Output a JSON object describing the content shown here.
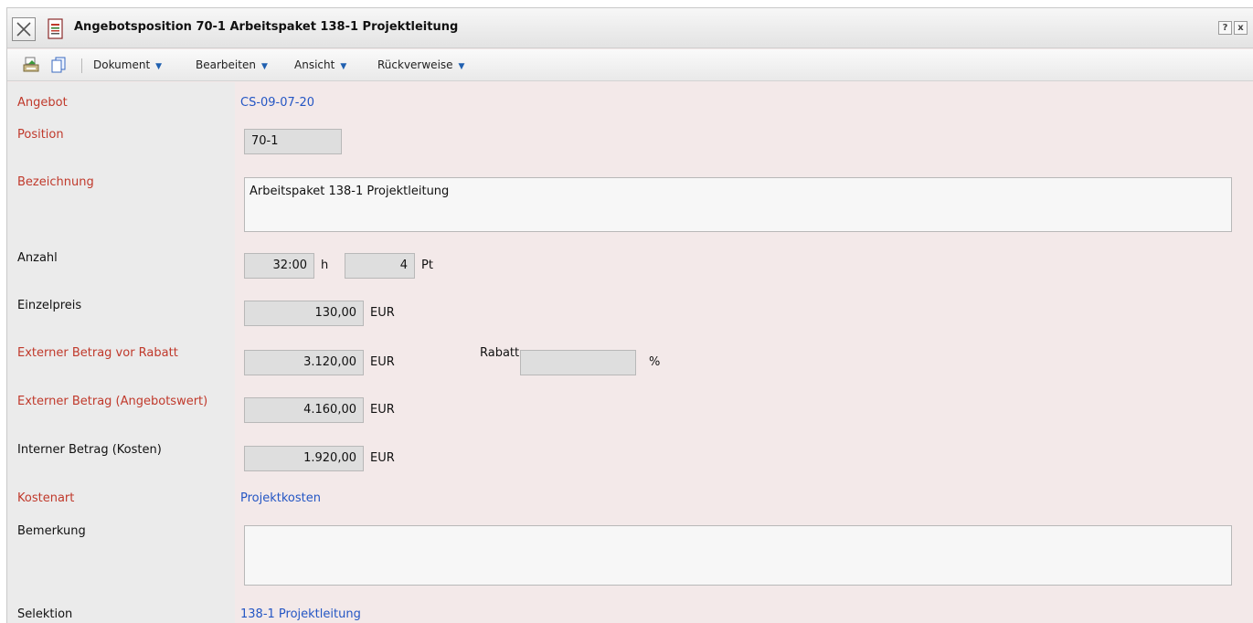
{
  "window": {
    "title": "Angebotsposition 70-1 Arbeitspaket 138-1 Projektleitung",
    "help_btn": "?",
    "close_btn": "x"
  },
  "toolbar": {
    "menus": [
      {
        "label": "Dokument"
      },
      {
        "label": "Bearbeiten"
      },
      {
        "label": "Ansicht"
      },
      {
        "label": "Rückverweise"
      }
    ],
    "caret": "▼"
  },
  "form": {
    "angebot": {
      "label": "Angebot",
      "value": "CS-09-07-20"
    },
    "position": {
      "label": "Position",
      "value": "70-1"
    },
    "bezeichnung": {
      "label": "Bezeichnung",
      "value": "Arbeitspaket 138-1 Projektleitung"
    },
    "anzahl": {
      "label": "Anzahl",
      "hours": "32:00",
      "hours_unit": "h",
      "days": "4",
      "days_unit": "Pt"
    },
    "einzelpreis": {
      "label": "Einzelpreis",
      "value": "130,00",
      "unit": "EUR"
    },
    "extern_vor_rabatt": {
      "label": "Externer Betrag vor Rabatt",
      "value": "3.120,00",
      "unit": "EUR"
    },
    "rabatt": {
      "label": "Rabatt",
      "value": "",
      "unit": "%"
    },
    "extern_angebotswert": {
      "label": "Externer Betrag (Angebotswert)",
      "value": "4.160,00",
      "unit": "EUR"
    },
    "intern_kosten": {
      "label": "Interner Betrag (Kosten)",
      "value": "1.920,00",
      "unit": "EUR"
    },
    "kostenart": {
      "label": "Kostenart",
      "value": "Projektkosten"
    },
    "bemerkung": {
      "label": "Bemerkung",
      "value": ""
    },
    "selektion": {
      "label": "Selektion",
      "value": "138-1 Projektleitung"
    }
  },
  "colors": {
    "required_label": "#c0392b",
    "link": "#2456c4",
    "form_bg": "#f3e9e9",
    "label_bg": "#ebebeb"
  }
}
